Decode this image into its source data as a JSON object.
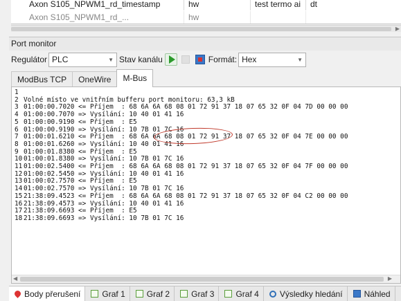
{
  "top_grid": {
    "rows": [
      [
        "Axon S105_NPWM1_rd_timestamp",
        "hw",
        "test termo ai",
        "dt"
      ],
      [
        "Axon S105_NPWM1_rd_...",
        "hw",
        "",
        ""
      ]
    ]
  },
  "panel": {
    "title": "Port monitor"
  },
  "toolbar": {
    "regulator_label": "Regulátor",
    "regulator_value": "PLC",
    "channel_label": "Stav kanálu",
    "format_label": "Formát:",
    "format_value": "Hex"
  },
  "tabs": [
    "ModBus TCP",
    "OneWire",
    "M-Bus"
  ],
  "log_lines": [
    [
      "1",
      ""
    ],
    [
      "2",
      "Volné místo ve vnitřním bufferu port monitoru: 63,3 kB"
    ],
    [
      "3",
      "01:00:00.7020 <= Příjem  : 68 6A 6A 68 08 01 72 91 37 18 07 65 32 0F 04 7D 00 00 00"
    ],
    [
      "4",
      "01:00:00.7070 => Vysílání: 10 40 01 41 16"
    ],
    [
      "5",
      "01:00:00.9190 <= Příjem  : E5"
    ],
    [
      "6",
      "01:00:00.9190 => Vysílání: 10 7B 01 7C 16"
    ],
    [
      "7",
      "01:00:01.6210 <= Příjem  : 68 6A 6A 68 08 01 72 91 37 18 07 65 32 0F 04 7E 00 00 00"
    ],
    [
      "8",
      "01:00:01.6260 => Vysílání: 10 40 01 41 16"
    ],
    [
      "9",
      "01:00:01.8380 <= Příjem  : E5"
    ],
    [
      "10",
      "01:00:01.8380 => Vysílání: 10 7B 01 7C 16"
    ],
    [
      "11",
      "01:00:02.5400 <= Příjem  : 68 6A 6A 68 08 01 72 91 37 18 07 65 32 0F 04 7F 00 00 00"
    ],
    [
      "12",
      "01:00:02.5450 => Vysílání: 10 40 01 41 16"
    ],
    [
      "13",
      "01:00:02.7570 <= Příjem  : E5"
    ],
    [
      "14",
      "01:00:02.7570 => Vysílání: 10 7B 01 7C 16"
    ],
    [
      "15",
      "21:38:09.4523 <= Příjem  : 68 6A 6A 68 08 01 72 91 37 18 07 65 32 0F 04 C2 00 00 00"
    ],
    [
      "16",
      "21:38:09.4573 => Vysílání: 10 40 01 41 16"
    ],
    [
      "17",
      "21:38:09.6693 <= Příjem  : E5"
    ],
    [
      "18",
      "21:38:09.6693 => Vysílání: 10 7B 01 7C 16"
    ]
  ],
  "bottom_tabs": [
    {
      "label": "Body přerušení",
      "icon": "breakpoint-icon"
    },
    {
      "label": "Graf 1",
      "icon": "graph-icon"
    },
    {
      "label": "Graf 2",
      "icon": "graph-icon"
    },
    {
      "label": "Graf 3",
      "icon": "graph-icon"
    },
    {
      "label": "Graf 4",
      "icon": "graph-icon"
    },
    {
      "label": "Výsledky hledání",
      "icon": "search-results-icon"
    },
    {
      "label": "Náhled",
      "icon": "preview-icon"
    }
  ],
  "colors": {
    "play": "#2b9a2b",
    "annotation_circle": "#c0392b"
  }
}
